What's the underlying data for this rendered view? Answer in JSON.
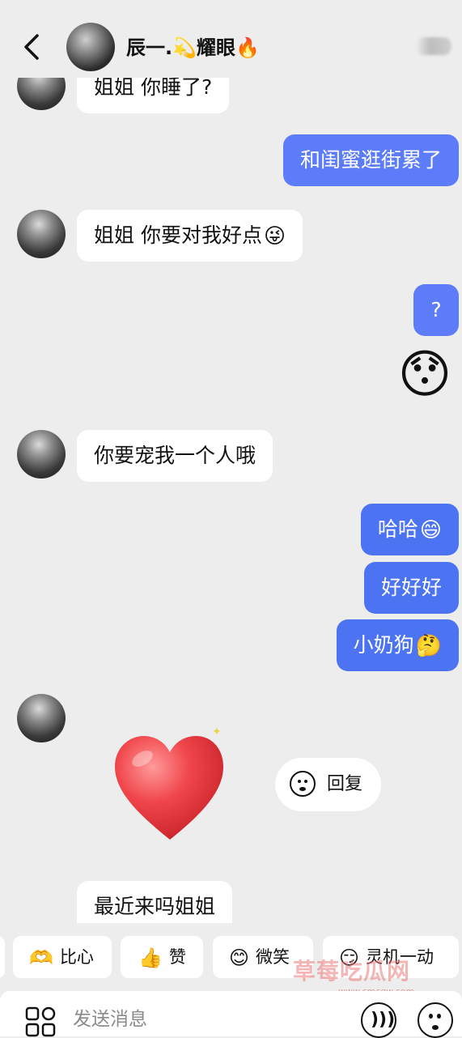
{
  "header": {
    "back_icon": "chevron-left-icon",
    "name": "辰一.",
    "name_emoji": "💫",
    "name_suffix": "耀眼",
    "name_emoji2": "🔥",
    "more_icon": "more-icon"
  },
  "messages": [
    {
      "side": "in",
      "text": "姐姐 你睡了?"
    },
    {
      "side": "out",
      "text": "和闺蜜逛街累了"
    },
    {
      "side": "in",
      "text": "姐姐 你要对我好点",
      "emoji": "😜"
    },
    {
      "side": "out",
      "text": "?"
    },
    {
      "side": "out",
      "sticker": "😯"
    },
    {
      "side": "in",
      "text": "你要宠我一个人哦"
    },
    {
      "side": "out",
      "text": "哈哈",
      "emoji": "😄"
    },
    {
      "side": "out",
      "text": "好好好"
    },
    {
      "side": "out",
      "text": "小奶狗",
      "emoji": "🤔"
    },
    {
      "side": "in",
      "sticker": "heart"
    },
    {
      "side": "in",
      "text": "最近来吗姐姐"
    }
  ],
  "reply_button": {
    "label": "回复",
    "icon": "smile-icon"
  },
  "quick_replies": [
    {
      "emoji": "🫶",
      "label": "比心"
    },
    {
      "emoji": "👍",
      "label": "赞"
    },
    {
      "emoji": "😊",
      "label": "微笑"
    },
    {
      "emoji": "😏",
      "label": "灵机一动"
    }
  ],
  "watermark": {
    "text": "草莓吃瓜网",
    "url": "www.cmcgw.com"
  },
  "input": {
    "placeholder": "发送消息",
    "voice_icon": "voice-icon",
    "emoji_icon": "emoji-icon",
    "apps_icon": "apps-grid-icon"
  }
}
